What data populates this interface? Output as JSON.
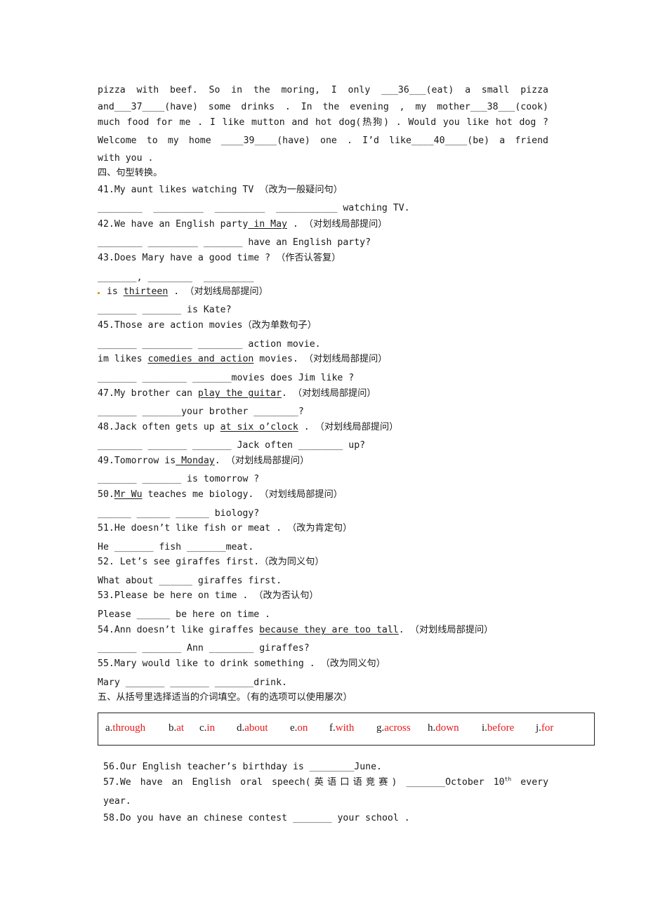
{
  "passage": {
    "lines": [
      "pizza with beef. So in the moring, I only ___36___(eat) a small pizza",
      "and___37____(have) some drinks . In the evening , my mother___38___(cook)",
      "much food for me . I like mutton and hot dog(热狗) . Would you like hot dog ?",
      "Welcome to my home  ____39____(have) one . I’d like____40____(be) a friend",
      "with you ."
    ]
  },
  "section4": {
    "title": "四、句型转换。",
    "items": [
      {
        "q_pre": "41.My aunt likes watching TV ",
        "q_u": "",
        "q_post": "",
        "hint": "（改为一般疑问句）",
        "answer": "________  _________  _________  ___________ watching TV."
      },
      {
        "q_pre": "42.We have an English party",
        "q_u": " in May",
        "q_post": " . ",
        "hint": "（对划线局部提问）",
        "answer": "________ _________ _______ have an English party?"
      },
      {
        "q_pre": "43.Does Mary have a good time ? ",
        "q_u": "",
        "q_post": "",
        "hint": "（作否认答复）",
        "answer": "_______, ________  _________"
      },
      {
        "q_pre": " is ",
        "q_u": "thirteen",
        "q_post": " . ",
        "hint": "（对划线局部提问）",
        "answer": "_______ _______ is Kate?",
        "mark": true
      },
      {
        "q_pre": "45.Those are action movies",
        "q_u": "",
        "q_post": "",
        "hint": "（改为单数句子）",
        "answer": "_______ _________ ________ action movie."
      },
      {
        "q_pre": "im likes ",
        "q_u": "comedies and action",
        "q_post": " movies. ",
        "hint": "（对划线局部提问）",
        "answer": "_______ ________ _______movies does Jim like ?"
      },
      {
        "q_pre": "47.My brother can ",
        "q_u": "play the guitar",
        "q_post": ". ",
        "hint": "（对划线局部提问）",
        "answer": "_______ _______your brother ________?"
      },
      {
        "q_pre": "48.Jack often gets up ",
        "q_u": "at six o’clock",
        "q_post": " . ",
        "hint": "（对划线局部提问）",
        "answer": "________ _______ _______ Jack often ________ up?"
      },
      {
        "q_pre": "49.Tomorrow is",
        "q_u": " Monday",
        "q_post": ". ",
        "hint": "（对划线局部提问）",
        "answer": "_______ _______ is tomorrow ?"
      },
      {
        "q_pre": "50.",
        "q_u": "Mr Wu",
        "q_post": " teaches me biology. ",
        "hint": "（对划线局部提问）",
        "answer": "______ ______ ______ biology?"
      },
      {
        "q_pre": "51.He doesn’t like fish or meat . ",
        "q_u": "",
        "q_post": "",
        "hint": "（改为肯定句）",
        "answer": "He _______ fish _______meat."
      },
      {
        "q_pre": "52. Let’s see giraffes first.",
        "q_u": "",
        "q_post": "",
        "hint": "（改为同义句）",
        "answer": "What about ______ giraffes first."
      },
      {
        "q_pre": "53.Please be here on time . ",
        "q_u": "",
        "q_post": "",
        "hint": "（改为否认句）",
        "answer": "Please ______ be here on time ."
      },
      {
        "q_pre": "54.Ann doesn’t like giraffes ",
        "q_u": "because they are too tall",
        "q_post": ". ",
        "hint": "（对划线局部提问）",
        "answer": "_______ _______ Ann ________ giraffes?"
      },
      {
        "q_pre": "55.Mary would like to drink something . ",
        "q_u": "",
        "q_post": "",
        "hint": "（改为同义句）",
        "answer": "Mary _______ _______ _______drink."
      }
    ]
  },
  "section5": {
    "title": "五、从括号里选择适当的介词填空。（有的选项可以使用屡次）",
    "options": [
      {
        "letter": "a.",
        "word": "through"
      },
      {
        "letter": "b.",
        "word": "at"
      },
      {
        "letter": "c.",
        "word": "in"
      },
      {
        "letter": "d.",
        "word": "about"
      },
      {
        "letter": "e.",
        "word": "on"
      },
      {
        "letter": "f.",
        "word": "with"
      },
      {
        "letter": "g.",
        "word": "across"
      },
      {
        "letter": "h.",
        "word": "down"
      },
      {
        "letter": "i.",
        "word": "before"
      },
      {
        "letter": "j.",
        "word": "for"
      }
    ],
    "questions": {
      "q56": "56.Our English teacher’s birthday is ________June.",
      "q57_a": "57.We have an English oral speech(英语口语竞赛) _______October 10",
      "q57_sup": "th",
      "q57_b": " every",
      "q57_c": "year.",
      "q58": "58.Do you have an chinese contest _______ your school ."
    },
    "colors": {
      "option_word": "#e8191c",
      "option_letter": "#1a1a1a"
    }
  }
}
